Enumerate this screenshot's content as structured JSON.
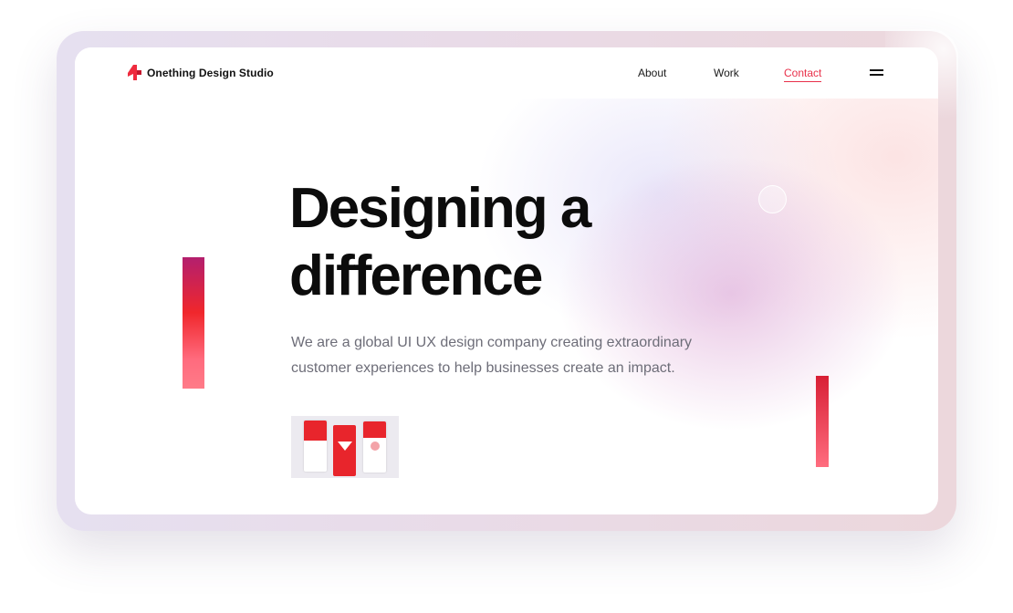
{
  "brand": {
    "name": "Onething Design Studio",
    "logo_icon": "stylized-4-logo-icon",
    "accent_color": "#e8304a"
  },
  "nav": {
    "items": [
      {
        "label": "About",
        "active": false
      },
      {
        "label": "Work",
        "active": false
      },
      {
        "label": "Contact",
        "active": true
      }
    ],
    "menu_icon": "hamburger-menu-icon"
  },
  "hero": {
    "title_line1": "Designing a",
    "title_line2": "difference",
    "description": "We are a global UI UX design company creating extraordinary customer experiences to help businesses create an impact.",
    "thumbnail_icon": "app-screens-thumbnail"
  },
  "colors": {
    "bar_gradient_top": "#b31f6e",
    "bar_gradient_mid": "#f0272c",
    "bar_gradient_bottom": "#ff7b88"
  }
}
